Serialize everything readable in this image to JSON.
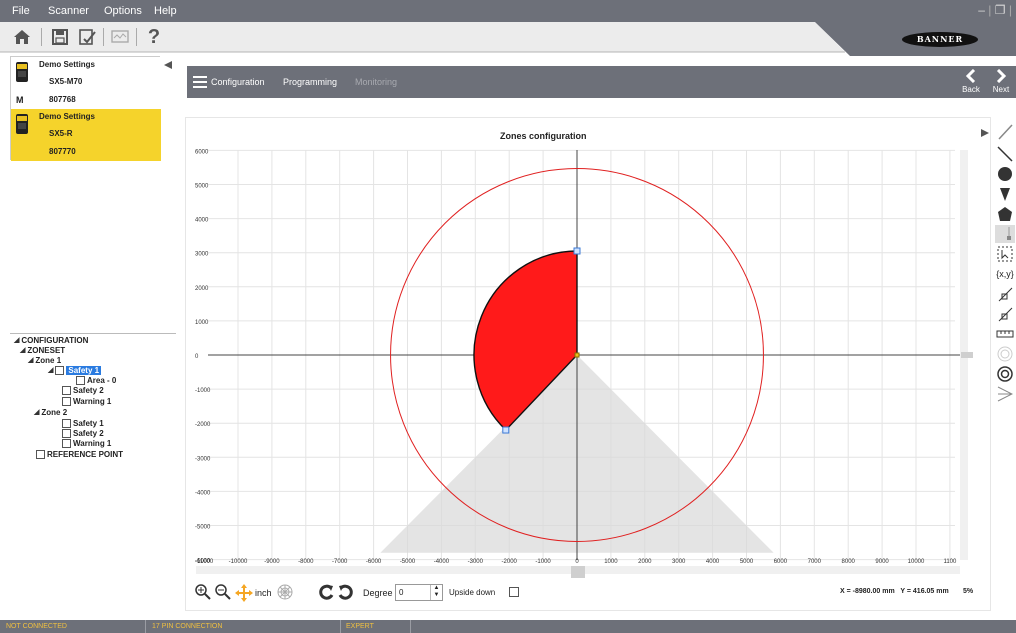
{
  "menu": {
    "file": "File",
    "scanner": "Scanner",
    "options": "Options",
    "help": "Help"
  },
  "toolbar": {
    "icons": [
      "home-icon",
      "save-icon",
      "checklist-icon",
      "monitor-icon",
      "help-icon"
    ],
    "help_label": "?",
    "brand": "BANNER"
  },
  "devices": [
    {
      "settings": "Demo Settings",
      "model": "SX5-M70",
      "serial": "807768",
      "badge": "M"
    },
    {
      "settings": "Demo Settings",
      "model": "SX5-R",
      "serial": "807770",
      "badge": ""
    }
  ],
  "tree": {
    "configuration": "CONFIGURATION",
    "zoneset": "ZONESET",
    "zone1": "Zone 1",
    "zone1_safety1": "Safety 1",
    "zone1_area0": "Area - 0",
    "zone1_safety2": "Safety 2",
    "zone1_warning1": "Warning 1",
    "zone2": "Zone 2",
    "zone2_safety1": "Safety 1",
    "zone2_safety2": "Safety 2",
    "zone2_warning1": "Warning 1",
    "reference_point": "REFERENCE POINT"
  },
  "nav": {
    "configuration": "Configuration",
    "programming": "Programming",
    "monitoring": "Monitoring",
    "back": "Back",
    "next": "Next"
  },
  "chart_data": {
    "type": "scatter",
    "title": "Zones configuration",
    "xlim": [
      -11000,
      11000
    ],
    "ylim": [
      -6000,
      6000
    ],
    "x_ticks": [
      -11000,
      -10000,
      -9000,
      -8000,
      -7000,
      -6000,
      -5000,
      -4000,
      -3000,
      -2000,
      -1000,
      0,
      1000,
      2000,
      3000,
      4000,
      5000,
      6000,
      7000,
      8000,
      9000,
      10000,
      11000
    ],
    "x_tick_labels": [
      "-11000",
      "-10000",
      "-9000",
      "-8000",
      "-7000",
      "-6000",
      "-5000",
      "-4000",
      "-3000",
      "-2000",
      "-1000",
      "0",
      "1000",
      "2000",
      "3000",
      "4000",
      "5000",
      "6000",
      "7000",
      "8000",
      "9000",
      "10000",
      "1100"
    ],
    "y_ticks": [
      6000,
      5000,
      4000,
      3000,
      2000,
      1000,
      0,
      -1000,
      -2000,
      -3000,
      -4000,
      -5000,
      -6000
    ],
    "y_tick_labels": [
      "6000",
      "5000",
      "4000",
      "3000",
      "2000",
      "1000",
      "0",
      "-1000",
      "-2000",
      "-3000",
      "-4000",
      "-5000",
      "-6000"
    ],
    "grid": true,
    "range_circle_radius": 5500,
    "safety_zone": {
      "radius": 3050,
      "start_point": [
        0,
        3050
      ],
      "end_point": [
        -2100,
        -2200
      ],
      "color": "#ff1a1a"
    },
    "scan_field_angle_deg": 270
  },
  "bottom": {
    "unit_label": "inch",
    "degree_label": "Degree",
    "degree_value": "0",
    "upside_down_label": "Upside down",
    "coords": "X = -8980.00 mm   Y = 416.05 mm",
    "zoom": "5%"
  },
  "status": {
    "connection": "NOT CONNECTED",
    "pin": "17 PIN CONNECTION",
    "mode": "EXPERT"
  },
  "colors": {
    "chrome": "#6d7079",
    "highlight": "#f5d32b",
    "accent": "#f0c040",
    "zone": "#ff1a1a",
    "range": "#e02020"
  }
}
